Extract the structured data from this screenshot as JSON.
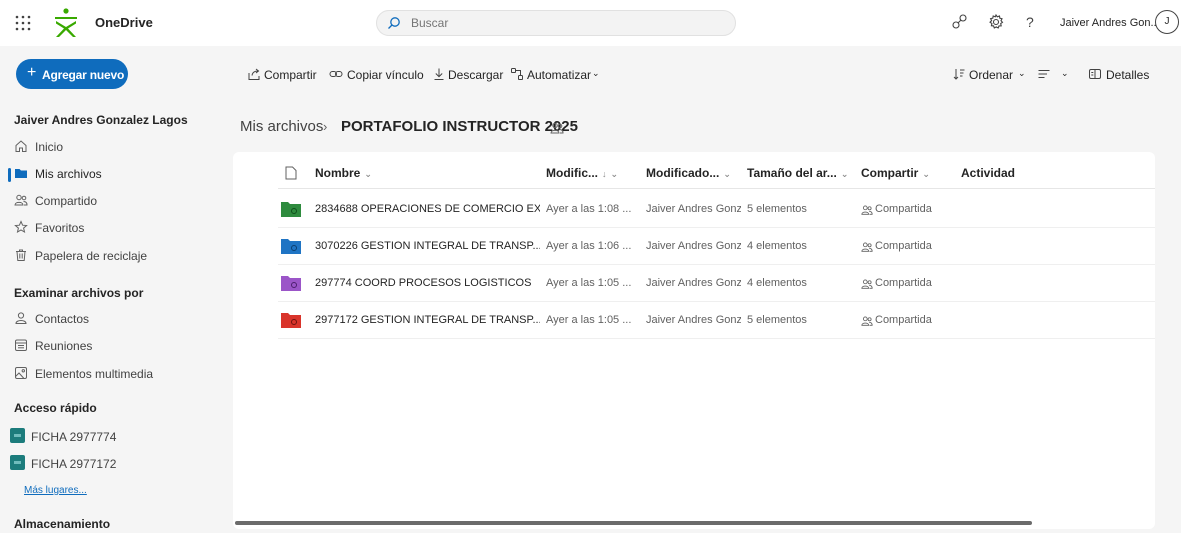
{
  "app": {
    "name": "OneDrive"
  },
  "search": {
    "placeholder": "Buscar"
  },
  "user": {
    "name": "Jaiver Andres Gon...",
    "initial": "J"
  },
  "sidebar": {
    "new_button": "Agregar nuevo",
    "account_name": "Jaiver Andres Gonzalez Lagos",
    "nav": [
      {
        "label": "Inicio",
        "icon": "home-icon"
      },
      {
        "label": "Mis archivos",
        "icon": "folder-icon",
        "active": true
      },
      {
        "label": "Compartido",
        "icon": "people-icon"
      },
      {
        "label": "Favoritos",
        "icon": "star-icon"
      },
      {
        "label": "Papelera de reciclaje",
        "icon": "trash-icon"
      }
    ],
    "browse_heading": "Examinar archivos por",
    "browse": [
      {
        "label": "Contactos",
        "icon": "contact-icon"
      },
      {
        "label": "Reuniones",
        "icon": "calendar-icon"
      },
      {
        "label": "Elementos multimedia",
        "icon": "image-icon"
      }
    ],
    "quick_heading": "Acceso rápido",
    "quick": [
      {
        "label": "FICHA 2977774"
      },
      {
        "label": "FICHA 2977172"
      }
    ],
    "more_places": "Más lugares...",
    "storage_heading": "Almacenamiento"
  },
  "commands": {
    "share": "Compartir",
    "copy_link": "Copiar vínculo",
    "download": "Descargar",
    "automate": "Automatizar",
    "sort": "Ordenar",
    "details": "Detalles"
  },
  "breadcrumb": {
    "root": "Mis archivos",
    "current": "PORTAFOLIO INSTRUCTOR 2025"
  },
  "table": {
    "columns": {
      "name": "Nombre",
      "modified": "Modific...",
      "modified_by": "Modificado...",
      "size": "Tamaño del ar...",
      "sharing": "Compartir",
      "activity": "Actividad"
    },
    "rows": [
      {
        "name": "2834688 OPERACIONES DE COMERCIO EX...",
        "modified": "Ayer a las 1:08 ...",
        "modified_by": "Jaiver Andres Gonz",
        "size": "5 elementos",
        "sharing": "Compartida",
        "color": "#2e8b3e"
      },
      {
        "name": "3070226 GESTION INTEGRAL DE TRANSP...",
        "modified": "Ayer a las 1:06 ...",
        "modified_by": "Jaiver Andres Gonz",
        "size": "4 elementos",
        "sharing": "Compartida",
        "color": "#1f74c4"
      },
      {
        "name": "297774 COORD PROCESOS LOGISTICOS",
        "modified": "Ayer a las 1:05 ...",
        "modified_by": "Jaiver Andres Gonz",
        "size": "4 elementos",
        "sharing": "Compartida",
        "color": "#9b55c8"
      },
      {
        "name": "2977172 GESTION INTEGRAL DE TRANSP...",
        "modified": "Ayer a las 1:05 ...",
        "modified_by": "Jaiver Andres Gonz",
        "size": "5 elementos",
        "sharing": "Compartida",
        "color": "#d9342b"
      }
    ]
  }
}
